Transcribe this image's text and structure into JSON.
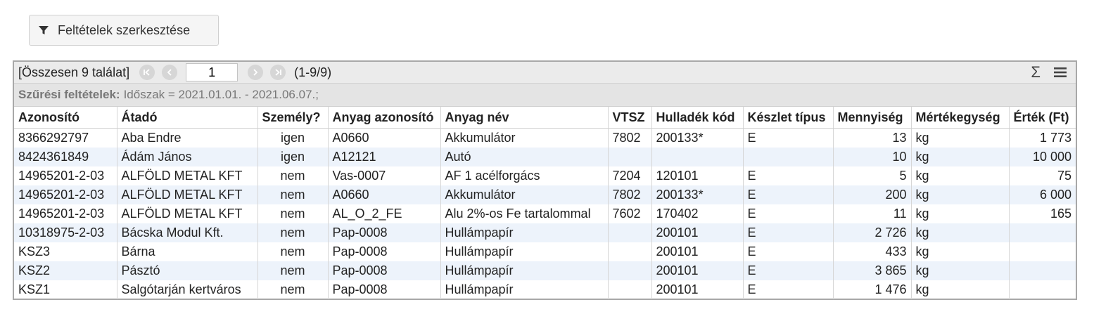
{
  "toolbar_button": {
    "label": "Feltételek szerkesztése",
    "icon": "filter-icon"
  },
  "pager": {
    "total_label": "[Összesen 9 találat]",
    "current_page": "1",
    "range_label": "(1-9/9)"
  },
  "filter": {
    "label": "Szűrési feltételek:",
    "text": "Időszak = 2021.01.01. - 2021.06.07.;"
  },
  "colors": {
    "header_bg": "#ebebeb",
    "filter_bg": "#e4e4e4",
    "row_alt": "#edf3fb",
    "border": "#a8a8a8"
  },
  "table": {
    "columns": [
      "Azonosító",
      "Átadó",
      "Személy?",
      "Anyag azonosító",
      "Anyag név",
      "VTSZ",
      "Hulladék kód",
      "Készlet típus",
      "Mennyiség",
      "Mértékegység",
      "Érték (Ft)"
    ],
    "rows": [
      [
        "8366292797",
        "Aba Endre",
        "igen",
        "A0660",
        "Akkumulátor",
        "7802",
        "200133*",
        "E",
        "13",
        "kg",
        "1 773"
      ],
      [
        "8424361849",
        "Ádám János",
        "igen",
        "A12121",
        "Autó",
        "",
        "",
        "",
        "10",
        "kg",
        "10 000"
      ],
      [
        "14965201-2-03",
        "ALFÖLD METAL KFT",
        "nem",
        "Vas-0007",
        "AF 1 acélforgács",
        "7204",
        "120101",
        "E",
        "5",
        "kg",
        "75"
      ],
      [
        "14965201-2-03",
        "ALFÖLD METAL KFT",
        "nem",
        "A0660",
        "Akkumulátor",
        "7802",
        "200133*",
        "E",
        "200",
        "kg",
        "6 000"
      ],
      [
        "14965201-2-03",
        "ALFÖLD METAL KFT",
        "nem",
        "AL_O_2_FE",
        "Alu 2%-os Fe tartalommal",
        "7602",
        "170402",
        "E",
        "11",
        "kg",
        "165"
      ],
      [
        "10318975-2-03",
        "Bácska Modul Kft.",
        "nem",
        "Pap-0008",
        "Hullámpapír",
        "",
        "200101",
        "E",
        "2 726",
        "kg",
        ""
      ],
      [
        "KSZ3",
        "Bárna",
        "nem",
        "Pap-0008",
        "Hullámpapír",
        "",
        "200101",
        "E",
        "433",
        "kg",
        ""
      ],
      [
        "KSZ2",
        "Pásztó",
        "nem",
        "Pap-0008",
        "Hullámpapír",
        "",
        "200101",
        "E",
        "3 865",
        "kg",
        ""
      ],
      [
        "KSZ1",
        "Salgótarján kertváros",
        "nem",
        "Pap-0008",
        "Hullámpapír",
        "",
        "200101",
        "E",
        "1 476",
        "kg",
        ""
      ]
    ]
  }
}
